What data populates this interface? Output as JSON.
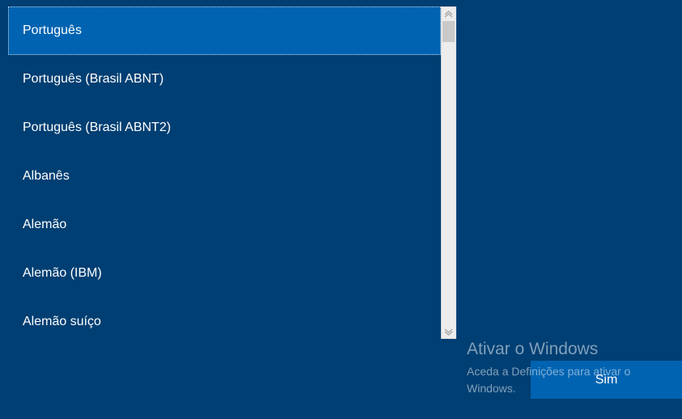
{
  "keyboard_list": {
    "items": [
      {
        "label": "Português",
        "selected": true
      },
      {
        "label": "Português (Brasil ABNT)",
        "selected": false
      },
      {
        "label": "Português (Brasil ABNT2)",
        "selected": false
      },
      {
        "label": "Albanês",
        "selected": false
      },
      {
        "label": "Alemão",
        "selected": false
      },
      {
        "label": "Alemão (IBM)",
        "selected": false
      },
      {
        "label": "Alemão suíço",
        "selected": false
      }
    ]
  },
  "scrollbar": {
    "up_icon": "chevron-up-icon",
    "down_icon": "chevron-down-icon"
  },
  "actions": {
    "confirm_label": "Sim"
  },
  "activation_watermark": {
    "title": "Ativar o Windows",
    "subtitle": "Aceda a Definições para ativar o Windows."
  },
  "colors": {
    "background": "#003f73",
    "selection": "#0063b1",
    "button": "#0063b1",
    "text": "#ffffff"
  }
}
